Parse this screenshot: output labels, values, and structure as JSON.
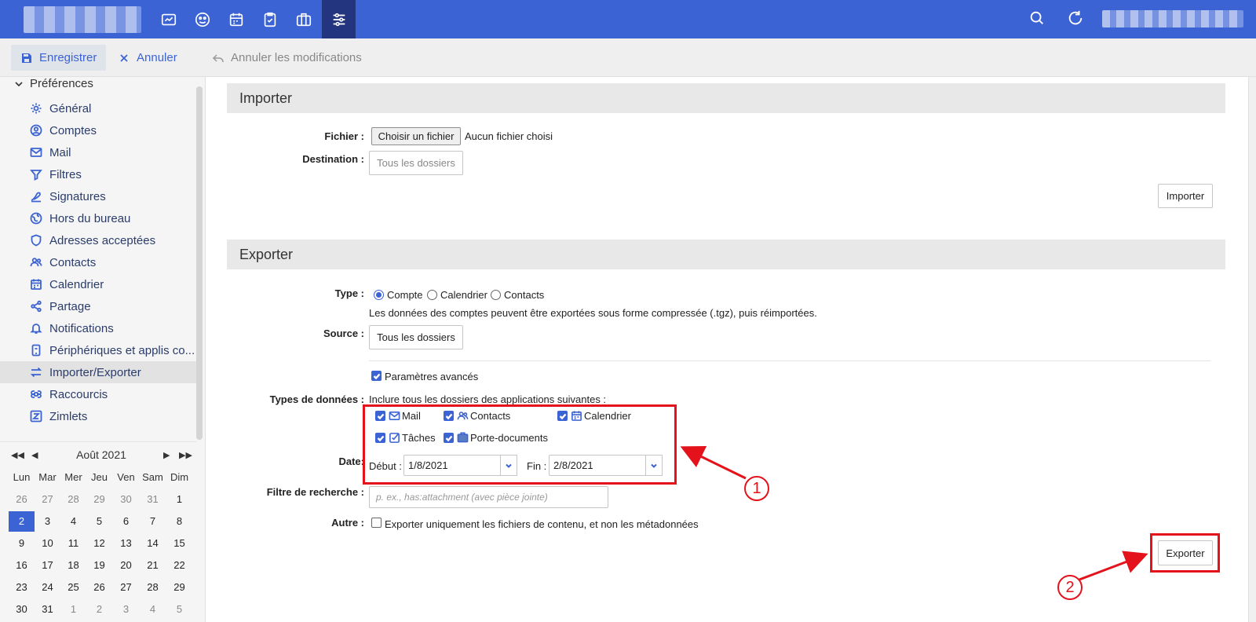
{
  "topbar": {
    "app_icons": [
      "mail-icon",
      "contacts-icon",
      "calendar-icon",
      "tasks-icon",
      "briefcase-icon",
      "preferences-icon"
    ],
    "right_icons": [
      "search-icon",
      "refresh-icon"
    ]
  },
  "toolbar": {
    "save_label": "Enregistrer",
    "cancel_label": "Annuler",
    "undo_label": "Annuler les modifications"
  },
  "sidebar": {
    "header": "Préférences",
    "items": [
      {
        "label": "Général",
        "icon": "gear-icon"
      },
      {
        "label": "Comptes",
        "icon": "account-icon"
      },
      {
        "label": "Mail",
        "icon": "mail-icon"
      },
      {
        "label": "Filtres",
        "icon": "filter-icon"
      },
      {
        "label": "Signatures",
        "icon": "signature-icon"
      },
      {
        "label": "Hors du bureau",
        "icon": "out-of-office-icon"
      },
      {
        "label": "Adresses acceptées",
        "icon": "shield-icon"
      },
      {
        "label": "Contacts",
        "icon": "contacts-icon"
      },
      {
        "label": "Calendrier",
        "icon": "calendar-icon"
      },
      {
        "label": "Partage",
        "icon": "share-icon"
      },
      {
        "label": "Notifications",
        "icon": "bell-icon"
      },
      {
        "label": "Périphériques et applis co...",
        "icon": "device-icon"
      },
      {
        "label": "Importer/Exporter",
        "icon": "import-export-icon"
      },
      {
        "label": "Raccourcis",
        "icon": "command-icon"
      },
      {
        "label": "Zimlets",
        "icon": "zimlet-icon"
      }
    ],
    "active_index": 12
  },
  "mini_calendar": {
    "title": "Août 2021",
    "nav": {
      "prev_year": "◀◀",
      "prev_month": "◀",
      "next_month": "▶",
      "next_year": "▶▶"
    },
    "weekdays": [
      "Lun",
      "Mar",
      "Mer",
      "Jeu",
      "Ven",
      "Sam",
      "Dim"
    ],
    "weeks": [
      [
        "26",
        "27",
        "28",
        "29",
        "30",
        "31",
        "1"
      ],
      [
        "2",
        "3",
        "4",
        "5",
        "6",
        "7",
        "8"
      ],
      [
        "9",
        "10",
        "11",
        "12",
        "13",
        "14",
        "15"
      ],
      [
        "16",
        "17",
        "18",
        "19",
        "20",
        "21",
        "22"
      ],
      [
        "23",
        "24",
        "25",
        "26",
        "27",
        "28",
        "29"
      ],
      [
        "30",
        "31",
        "1",
        "2",
        "3",
        "4",
        "5"
      ]
    ],
    "today": "2"
  },
  "import": {
    "title": "Importer",
    "file_label": "Fichier :",
    "file_button": "Choisir un fichier",
    "file_status": "Aucun fichier choisi",
    "destination_label": "Destination :",
    "destination_value": "Tous les dossiers",
    "import_button": "Importer"
  },
  "export": {
    "title": "Exporter",
    "type_label": "Type :",
    "type_options": [
      "Compte",
      "Calendrier",
      "Contacts"
    ],
    "type_selected": "Compte",
    "type_help": "Les données des comptes peuvent être exportées sous forme compressée (.tgz), puis réimportées.",
    "source_label": "Source :",
    "source_value": "Tous les dossiers",
    "advanced_label": "Paramètres avancés",
    "data_types_label": "Types de données :",
    "data_types_help": "Inclure tous les dossiers des applications suivantes :",
    "data_types": [
      {
        "label": "Mail",
        "icon": "mail-icon",
        "checked": true
      },
      {
        "label": "Contacts",
        "icon": "contacts-icon",
        "checked": true
      },
      {
        "label": "Calendrier",
        "icon": "calendar-icon",
        "checked": true
      },
      {
        "label": "Tâches",
        "icon": "tasks-icon",
        "checked": true
      },
      {
        "label": "Porte-documents",
        "icon": "briefcase-icon",
        "checked": true
      }
    ],
    "date_label": "Date:",
    "start_label": "Début :",
    "start_value": "1/8/2021",
    "end_label": "Fin :",
    "end_value": "2/8/2021",
    "search_label": "Filtre de recherche :",
    "search_placeholder": "p. ex., has:attachment (avec pièce jointe)",
    "other_label": "Autre :",
    "other_option": "Exporter uniquement les fichiers de contenu, et non les métadonnées",
    "export_button": "Exporter"
  },
  "annotations": {
    "marker_1": "1",
    "marker_2": "2",
    "color": "#e3121b"
  },
  "colors": {
    "accent": "#3c63d4",
    "topbar_active": "#23357e"
  }
}
